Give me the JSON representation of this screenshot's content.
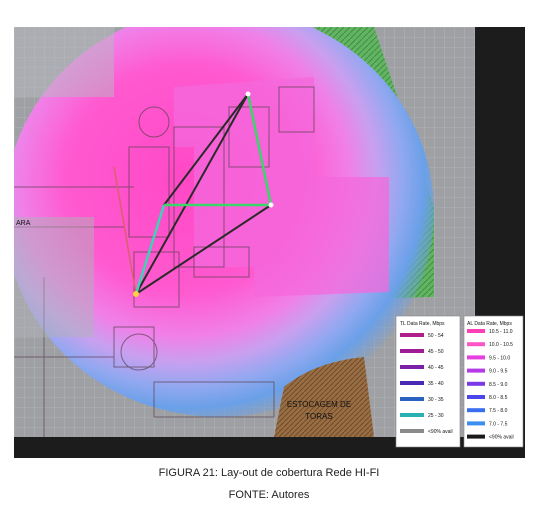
{
  "figure": {
    "map_labels": {
      "stockpile": "ESTOCAGEM DE",
      "stockpile_line2": "TORAS",
      "left_edge_tag": "ARA"
    },
    "legend_tl": {
      "title": "TL Data Rate, Mbps",
      "items": [
        {
          "label": "50 - 54",
          "color": "#b0208a"
        },
        {
          "label": "45 - 50",
          "color": "#a01c96"
        },
        {
          "label": "40 - 45",
          "color": "#7a1fa8"
        },
        {
          "label": "35 - 40",
          "color": "#4a2ab4"
        },
        {
          "label": "30 - 35",
          "color": "#2a62c4"
        },
        {
          "label": "25 - 30",
          "color": "#2ab0b4"
        },
        {
          "label": "<90% avail",
          "color": "#8a8a8a"
        }
      ]
    },
    "legend_al": {
      "title": "AL Data Rate, Mbps",
      "items": [
        {
          "label": "10.5 - 11.0",
          "color": "#ff3fb4"
        },
        {
          "label": "10.0 - 10.5",
          "color": "#ff55c8"
        },
        {
          "label": "9.5 - 10.0",
          "color": "#e63fe0"
        },
        {
          "label": "9.0 - 9.5",
          "color": "#b43ae8"
        },
        {
          "label": "8.5 - 9.0",
          "color": "#7a3ae8"
        },
        {
          "label": "8.0 - 8.5",
          "color": "#4a46ec"
        },
        {
          "label": "7.5 - 8.0",
          "color": "#3a6ef0"
        },
        {
          "label": "7.0 - 7.5",
          "color": "#3a8ef0"
        },
        {
          "label": "<90% avail",
          "color": "#1a1a1a"
        }
      ]
    }
  },
  "caption": {
    "line1": "FIGURA 21: Lay-out de cobertura Rede HI-FI",
    "line2": "FONTE: Autores"
  }
}
